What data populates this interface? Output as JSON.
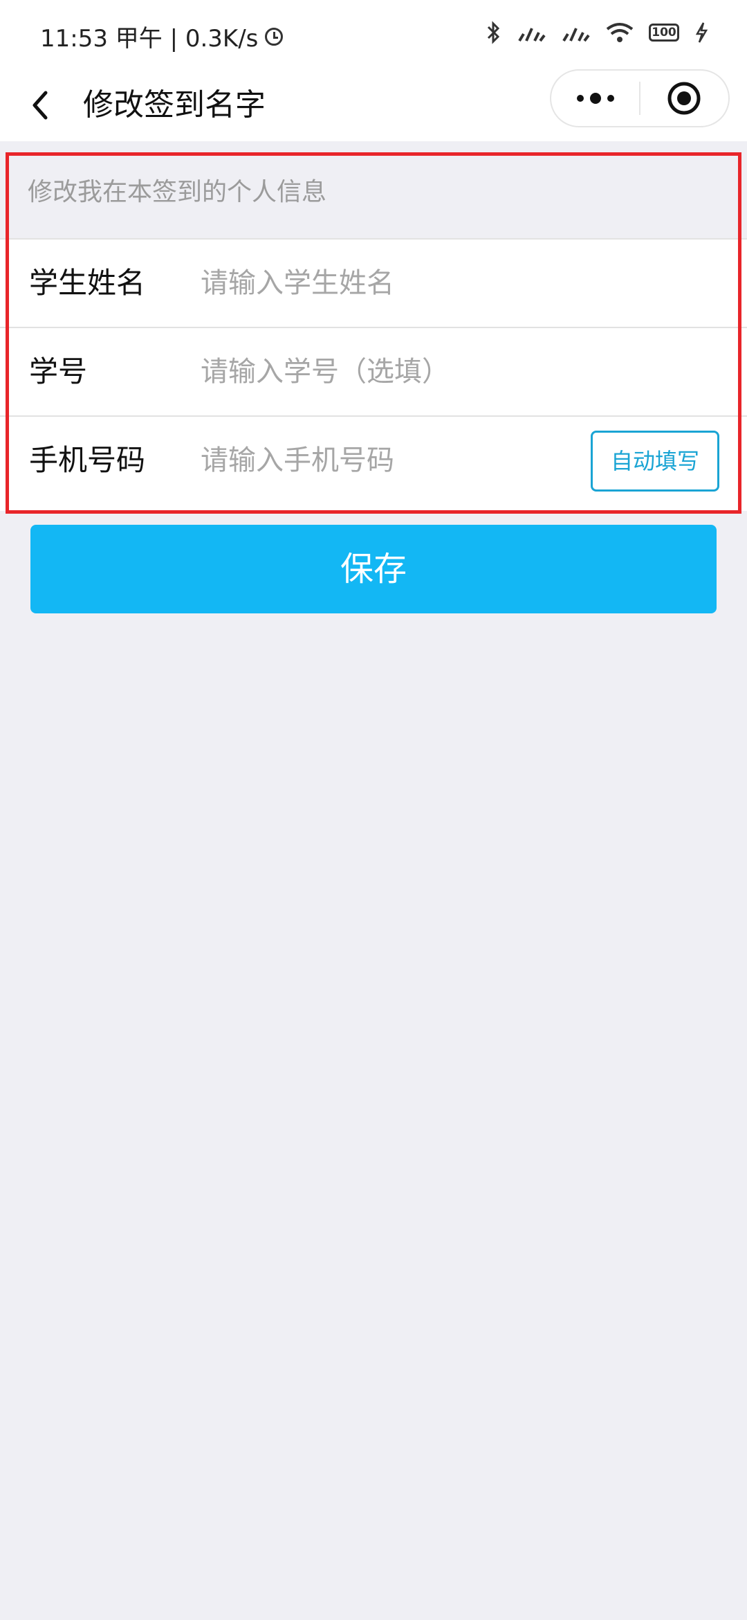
{
  "status_bar": {
    "time_text": "11:53 甲午 | 0.3K/s",
    "battery": "100",
    "icons": [
      "clock-icon",
      "bluetooth-icon",
      "signal-1-icon",
      "signal-2-icon",
      "wifi-icon",
      "battery-icon",
      "charging-icon"
    ]
  },
  "nav": {
    "title": "修改签到名字",
    "back_icon": "chevron-left-icon",
    "more_icon": "more-dots-icon",
    "close_icon": "target-circle-icon"
  },
  "form": {
    "section_title": "修改我在本签到的个人信息",
    "student_name": {
      "label": "学生姓名",
      "value": "",
      "placeholder": "请输入学生姓名"
    },
    "student_id": {
      "label": "学号",
      "value": "",
      "placeholder": "请输入学号（选填）"
    },
    "phone": {
      "label": "手机号码",
      "value": "",
      "placeholder": "请输入手机号码",
      "autofill_label": "自动填写"
    }
  },
  "save_label": "保存",
  "colors": {
    "accent": "#13b7f4",
    "autofill": "#1aa4d4",
    "highlight": "#e8252a",
    "page_bg": "#efeff4"
  }
}
